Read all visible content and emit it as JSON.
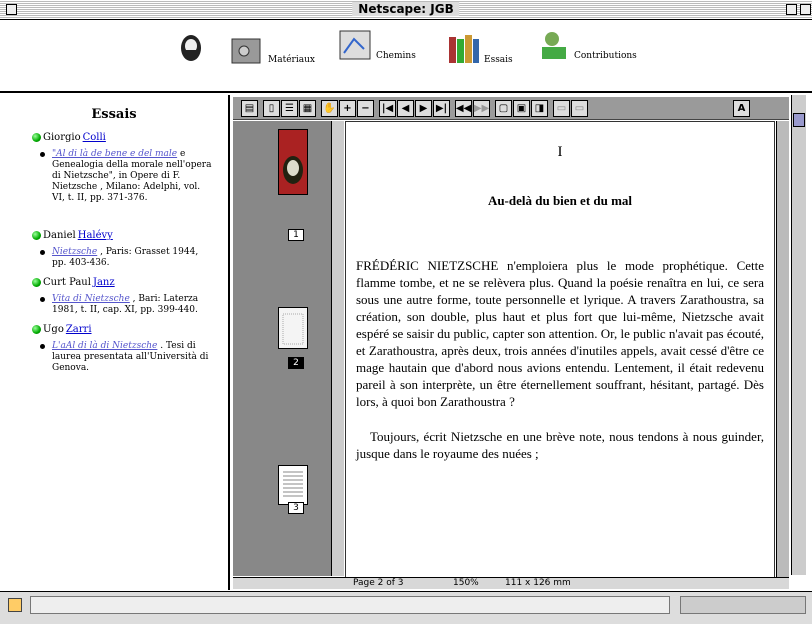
{
  "window": {
    "title": "Netscape: JGB"
  },
  "nav": {
    "items": [
      {
        "label": "Matériaux"
      },
      {
        "label": "Chemins"
      },
      {
        "label": "Essais"
      },
      {
        "label": "Contributions"
      }
    ]
  },
  "left": {
    "heading": "Essais",
    "entries": [
      {
        "first": "Giorgio",
        "last": "Colli",
        "work_link": "\"Al di là de bene e del male",
        "work_rest": " e Genealogia della morale  nell'opera di Nietzsche\", in Opere di F. Nietzsche  , Milano: Adelphi, vol. VI, t. II, pp. 371-376."
      },
      {
        "first": "Daniel",
        "last": "Halévy",
        "work_link": "Nietzsche",
        "work_rest": " , Paris: Grasset 1944, pp. 403-436."
      },
      {
        "first": "Curt Paul",
        "last": "Janz",
        "work_link": "Vita di Nietzsche",
        "work_rest": " , Bari: Laterza 1981, t. II, cap. XI, pp. 399-440."
      },
      {
        "first": "Ugo",
        "last": "Zarri",
        "work_link": "L'aAl di là di Nietzsche",
        "work_rest": " . Tesi di laurea presentata all'Università di Genova."
      }
    ]
  },
  "pdf": {
    "chapter": "I",
    "heading": "Au-delà du bien et du mal",
    "para1": "FRÉDÉRIC NIETZSCHE n'emploiera plus le mode prophétique. Cette flamme tombe, et ne se relèvera plus. Quand la poésie renaîtra en lui, ce sera sous une autre forme, toute personnelle et lyrique. A travers Zarathoustra, sa création, son double, plus haut et plus fort que lui-même, Nietzsche avait espéré se saisir du public, capter son attention. Or, le public n'avait pas écouté, et Zarathoustra, après deux, trois années d'inutiles appels, avait cessé d'être ce mage hautain que d'abord nous avions entendu. Lentement, il était redevenu pareil à son interprète, un être éternellement souffrant, hésitant, partagé. Dès lors, à quoi bon Zarathoustra ?",
    "para2": "Toujours, écrit Nietzsche en une brève note, nous tendons à nous guinder, jusque dans le royaume des nuées ;",
    "thumb_labels": [
      "1",
      "2",
      "3"
    ],
    "status_page": "Page 2 of 3",
    "status_zoom": "150%",
    "status_size": "111 x 126 mm"
  }
}
